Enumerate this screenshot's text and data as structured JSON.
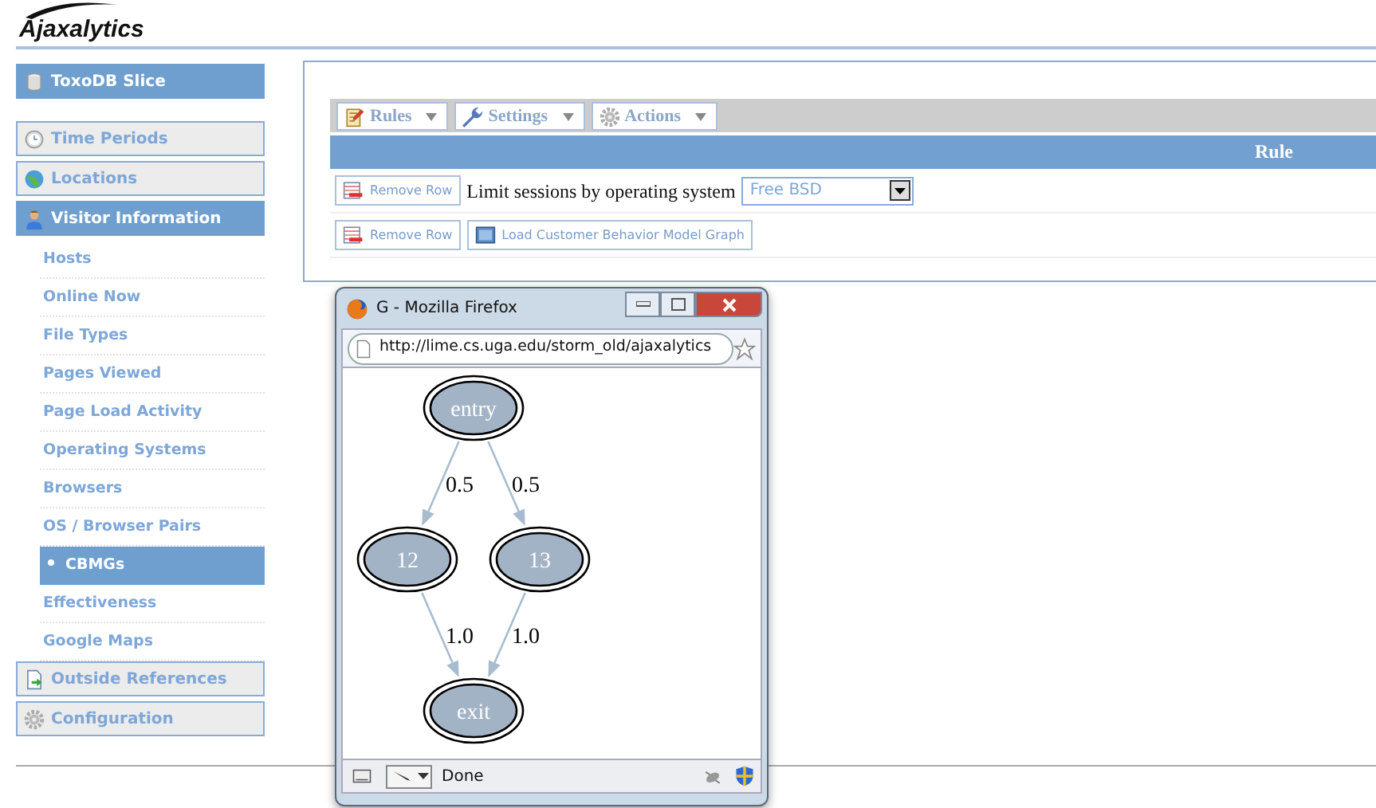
{
  "header": {
    "logo": "Ajaxalytics"
  },
  "sidebar": {
    "slice": {
      "label": "ToxoDB Slice"
    },
    "sections": [
      {
        "label": "Time Periods",
        "expanded": false
      },
      {
        "label": "Locations",
        "expanded": false
      },
      {
        "label": "Visitor Information",
        "expanded": true,
        "children": [
          {
            "label": "Hosts",
            "selected": false
          },
          {
            "label": "Online Now",
            "selected": false
          },
          {
            "label": "File Types",
            "selected": false
          },
          {
            "label": "Pages Viewed",
            "selected": false
          },
          {
            "label": "Page Load Activity",
            "selected": false
          },
          {
            "label": "Operating Systems",
            "selected": false
          },
          {
            "label": "Browsers",
            "selected": false
          },
          {
            "label": "OS / Browser Pairs",
            "selected": false
          },
          {
            "label": "CBMGs",
            "selected": true
          },
          {
            "label": "Effectiveness",
            "selected": false
          },
          {
            "label": "Google Maps",
            "selected": false
          }
        ]
      },
      {
        "label": "Outside References",
        "expanded": false
      },
      {
        "label": "Configuration",
        "expanded": false
      }
    ]
  },
  "toolbar": {
    "menus": [
      "Rules",
      "Settings",
      "Actions"
    ]
  },
  "table": {
    "column": "Rule",
    "rows": [
      {
        "kind": "filter",
        "remove": "Remove Row",
        "label": "Limit sessions by operating system",
        "value": "Free BSD"
      },
      {
        "kind": "actions",
        "remove": "Remove Row",
        "button": "Load Customer Behavior Model Graph"
      }
    ]
  },
  "popup": {
    "title": "G - Mozilla Firefox",
    "url": "http://lime.cs.uga.edu/storm_old/ajaxalytics",
    "status": "Done",
    "graph": {
      "layers": [
        [
          {
            "label": "entry",
            "edges": [
              {
                "label": "0.5"
              },
              {
                "label": "0.5"
              }
            ]
          }
        ],
        [
          {
            "label": "12",
            "edges": [
              {
                "label": "1.0"
              }
            ]
          },
          {
            "label": "13",
            "edges": [
              {
                "label": "1.0"
              }
            ]
          }
        ],
        [
          {
            "label": "exit"
          }
        ]
      ]
    }
  }
}
